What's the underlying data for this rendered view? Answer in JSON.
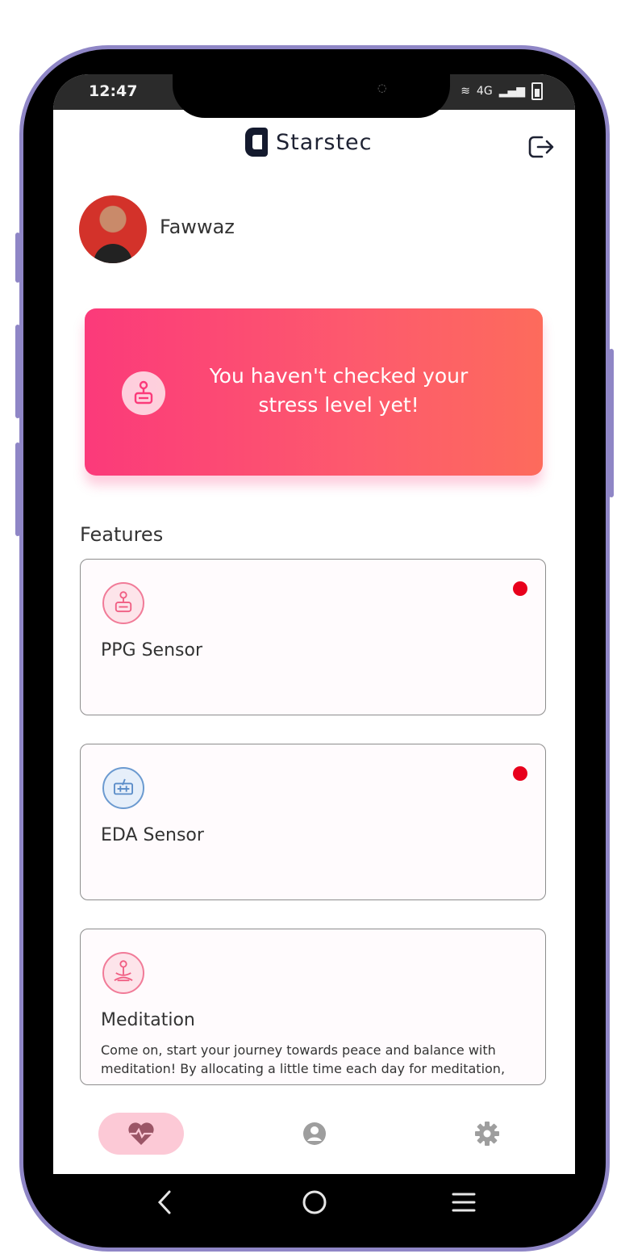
{
  "status_bar": {
    "time": "12:47",
    "network": "4G"
  },
  "header": {
    "brand": "Starstec"
  },
  "profile": {
    "name": "Fawwaz"
  },
  "banner": {
    "message": "You haven't checked your stress level yet!"
  },
  "features": {
    "title": "Features",
    "items": [
      {
        "label": "PPG Sensor",
        "icon": "ppg-sensor-icon",
        "has_notification": true
      },
      {
        "label": "EDA Sensor",
        "icon": "eda-sensor-icon",
        "has_notification": true
      },
      {
        "label": "Meditation",
        "icon": "meditation-icon",
        "has_notification": false,
        "description": "Come on, start your journey towards peace and balance with meditation! By allocating a little time each day for meditation,"
      }
    ]
  },
  "bottom_nav": {
    "items": [
      "heart-pulse-icon",
      "profile-icon",
      "settings-icon"
    ],
    "active": 0
  },
  "colors": {
    "accent": "#fb3a7a",
    "banner_end": "#fd6b5c",
    "notification": "#e8001c",
    "nav_active_bg": "#fcc9d6"
  }
}
